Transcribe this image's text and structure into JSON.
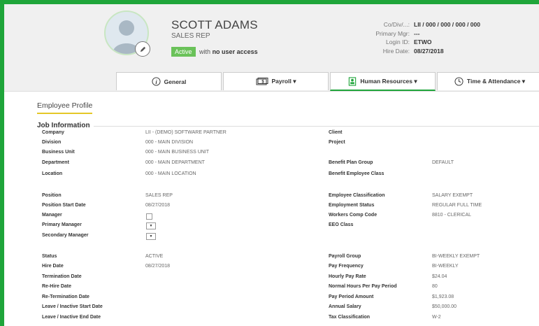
{
  "employee": {
    "name": "SCOTT ADAMS",
    "title": "SALES REP",
    "status": "Active",
    "status_suffix": "with",
    "status_emph": "no user access"
  },
  "meta": {
    "labels": [
      "Co/Div/...:",
      "Primary Mgr:",
      "Login ID:",
      "Hire Date:"
    ],
    "values": [
      "LII / 000 / 000 / 000 / 000",
      "---",
      "ETWO",
      "08/27/2018"
    ]
  },
  "tabs": [
    {
      "label": "General",
      "icon": "info-icon"
    },
    {
      "label": "Payroll ▾",
      "icon": "money-icon"
    },
    {
      "label": "Human Resources ▾",
      "icon": "id-card-icon"
    },
    {
      "label": "Time & Attendance ▾",
      "icon": "clock-icon"
    }
  ],
  "section_title": "Employee Profile",
  "group_title": "Job Information",
  "left_labels": [
    "Company",
    "Division",
    "Business Unit",
    "Department",
    "Location",
    "Position",
    "Position Start Date",
    "Manager",
    "Primary Manager",
    "Secondary Manager",
    "Status",
    "Hire Date",
    "Termination Date",
    "Re-Hire Date",
    "Re-Termination Date",
    "Leave / Inactive Start Date",
    "Leave / Inactive End Date"
  ],
  "left_values": [
    "LII - (DEMO) SOFTWARE PARTNER",
    "000 - MAIN DIVISION",
    "000 - MAIN BUSINESS UNIT",
    "000 - MAIN DEPARTMENT",
    "000 - MAIN LOCATION",
    "SALES REP",
    "08/27/2018",
    "",
    "",
    "",
    "ACTIVE",
    "08/27/2018",
    "",
    "",
    "",
    "",
    ""
  ],
  "right_labels": [
    "Client",
    "Project",
    "",
    "Benefit Plan Group",
    "Benefit Employee Class",
    "Employee Classification",
    "Employment Status",
    "Workers Comp Code",
    "EEO Class",
    "",
    "Payroll Group",
    "Pay Frequency",
    "Hourly Pay Rate",
    "Normal Hours Per Pay Period",
    "Pay Period Amount",
    "Annual Salary",
    "Tax Classification"
  ],
  "right_values": [
    "",
    "",
    "",
    "DEFAULT",
    "",
    "SALARY EXEMPT",
    "REGULAR FULL TIME",
    "8810 - CLERICAL",
    "",
    "",
    "BI-WEEKLY EXEMPT",
    "BI-WEEKLY",
    "$24.04",
    "80",
    "$1,923.08",
    "$50,000.00",
    "W-2"
  ],
  "dropdown_glyph": "▼"
}
